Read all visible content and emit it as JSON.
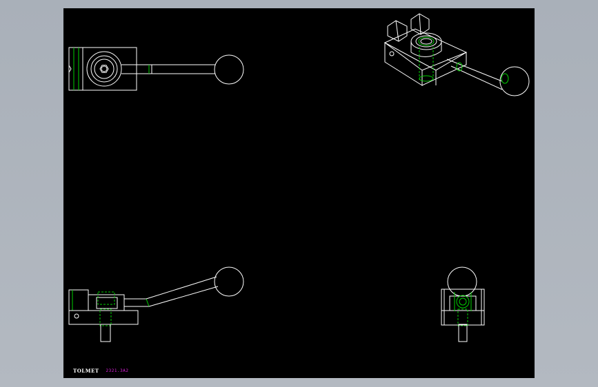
{
  "drawing": {
    "background": "#000000",
    "frame_color": "#ffffff",
    "hidden_color": "#00d000",
    "views": [
      {
        "name": "top-view"
      },
      {
        "name": "isometric-view"
      },
      {
        "name": "front-view"
      },
      {
        "name": "side-view"
      }
    ]
  },
  "title_block": {
    "logo_text": "TOLMET",
    "code": "2321.3A2",
    "code_color": "#e020e0"
  }
}
